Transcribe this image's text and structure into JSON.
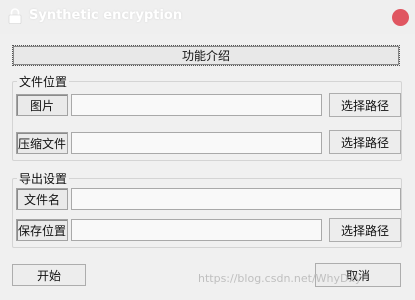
{
  "window": {
    "title": "Synthetic encryption",
    "close_color": "#e05661"
  },
  "toolbar": {
    "intro_button": "功能介绍"
  },
  "file_location": {
    "title": "文件位置",
    "image_label": "图片",
    "image_value": "",
    "archive_label": "压缩文件",
    "archive_value": "",
    "browse_label": "选择路径"
  },
  "export_settings": {
    "title": "导出设置",
    "filename_label": "文件名",
    "filename_value": "",
    "save_label": "保存位置",
    "save_value": "",
    "browse_label": "选择路径"
  },
  "footer": {
    "start_button": "开始",
    "cancel_button": "取消",
    "watermark": "https://blog.csdn.net/WhyDxy"
  }
}
